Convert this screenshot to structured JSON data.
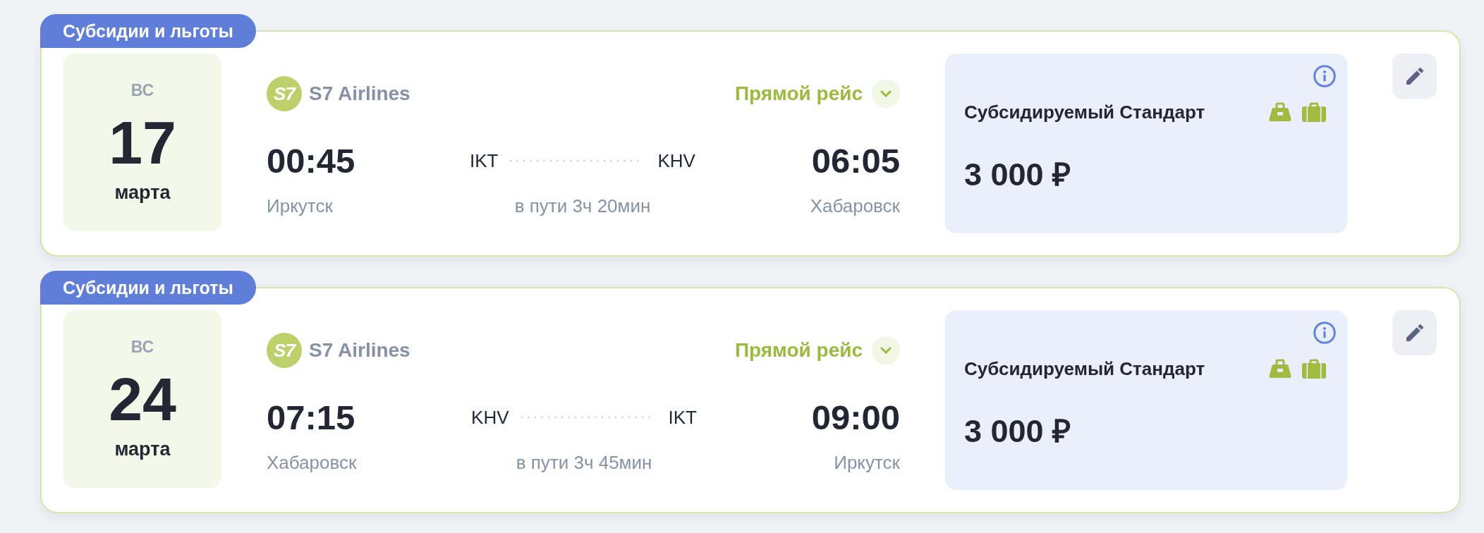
{
  "flights": [
    {
      "tag": "Субсидии и льготы",
      "date": {
        "weekday": "ВС",
        "day": "17",
        "month": "марта"
      },
      "airline": {
        "logo_text": "S7",
        "name": "S7 Airlines"
      },
      "route_type": "Прямой рейс",
      "expanded": false,
      "departure": {
        "time": "00:45",
        "code": "IKT",
        "city": "Иркутск"
      },
      "arrival": {
        "time": "06:05",
        "code": "KHV",
        "city": "Хабаровск"
      },
      "duration": "в пути 3ч 20мин",
      "fare": {
        "name": "Субсидируемый Стандарт",
        "price": "3 000 ₽",
        "baggage": [
          {
            "kind": "hand"
          },
          {
            "kind": "checked"
          }
        ]
      }
    },
    {
      "tag": "Субсидии и льготы",
      "date": {
        "weekday": "ВС",
        "day": "24",
        "month": "марта"
      },
      "airline": {
        "logo_text": "S7",
        "name": "S7 Airlines"
      },
      "route_type": "Прямой рейс",
      "expanded": false,
      "departure": {
        "time": "07:15",
        "code": "KHV",
        "city": "Хабаровск"
      },
      "arrival": {
        "time": "09:00",
        "code": "IKT",
        "city": "Иркутск"
      },
      "duration": "в пути 3ч 45мин",
      "fare": {
        "name": "Субсидируемый Стандарт",
        "price": "3 000 ₽",
        "baggage": [
          {
            "kind": "hand"
          },
          {
            "kind": "checked"
          }
        ]
      }
    }
  ]
}
